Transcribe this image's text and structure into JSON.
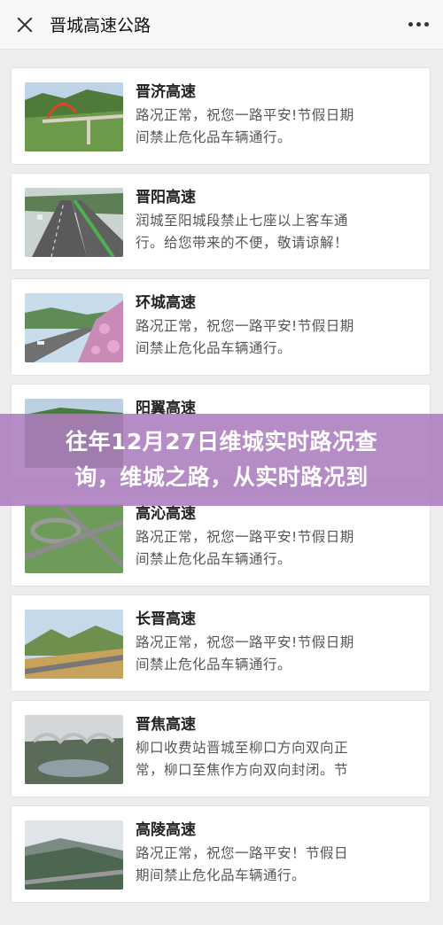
{
  "header": {
    "title": "晋城高速公路"
  },
  "roads": [
    {
      "name": "晋济高速",
      "line1": "路况正常，祝您一路平安!节假日期",
      "line2": "间禁止危化品车辆通行。"
    },
    {
      "name": "晋阳高速",
      "line1": "润城至阳城段禁止七座以上客车通",
      "line2": "行。给您带来的不便，敬请谅解！"
    },
    {
      "name": "环城高速",
      "line1": "路况正常，祝您一路平安!节假日期",
      "line2": "间禁止危化品车辆通行。"
    },
    {
      "name": "阳翼高速",
      "line1": "",
      "line2": ""
    },
    {
      "name": "高沁高速",
      "line1": "路况正常，祝您一路平安!节假日期",
      "line2": "间禁止危化品车辆通行。"
    },
    {
      "name": "长晋高速",
      "line1": "路况正常，祝您一路平安!节假日期",
      "line2": "间禁止危化品车辆通行。"
    },
    {
      "name": "晋焦高速",
      "line1": "柳口收费站晋城至柳口方向双向正",
      "line2": "常，柳口至焦作方向双向封闭。节"
    },
    {
      "name": "高陵高速",
      "line1": "路况正常，祝您一路平安！节假日",
      "line2": "期间禁止危化品车辆通行。"
    }
  ],
  "banner": {
    "line1": "往年12月27日维城实时路况查",
    "line2": "询，维城之路，从实时路况到"
  }
}
